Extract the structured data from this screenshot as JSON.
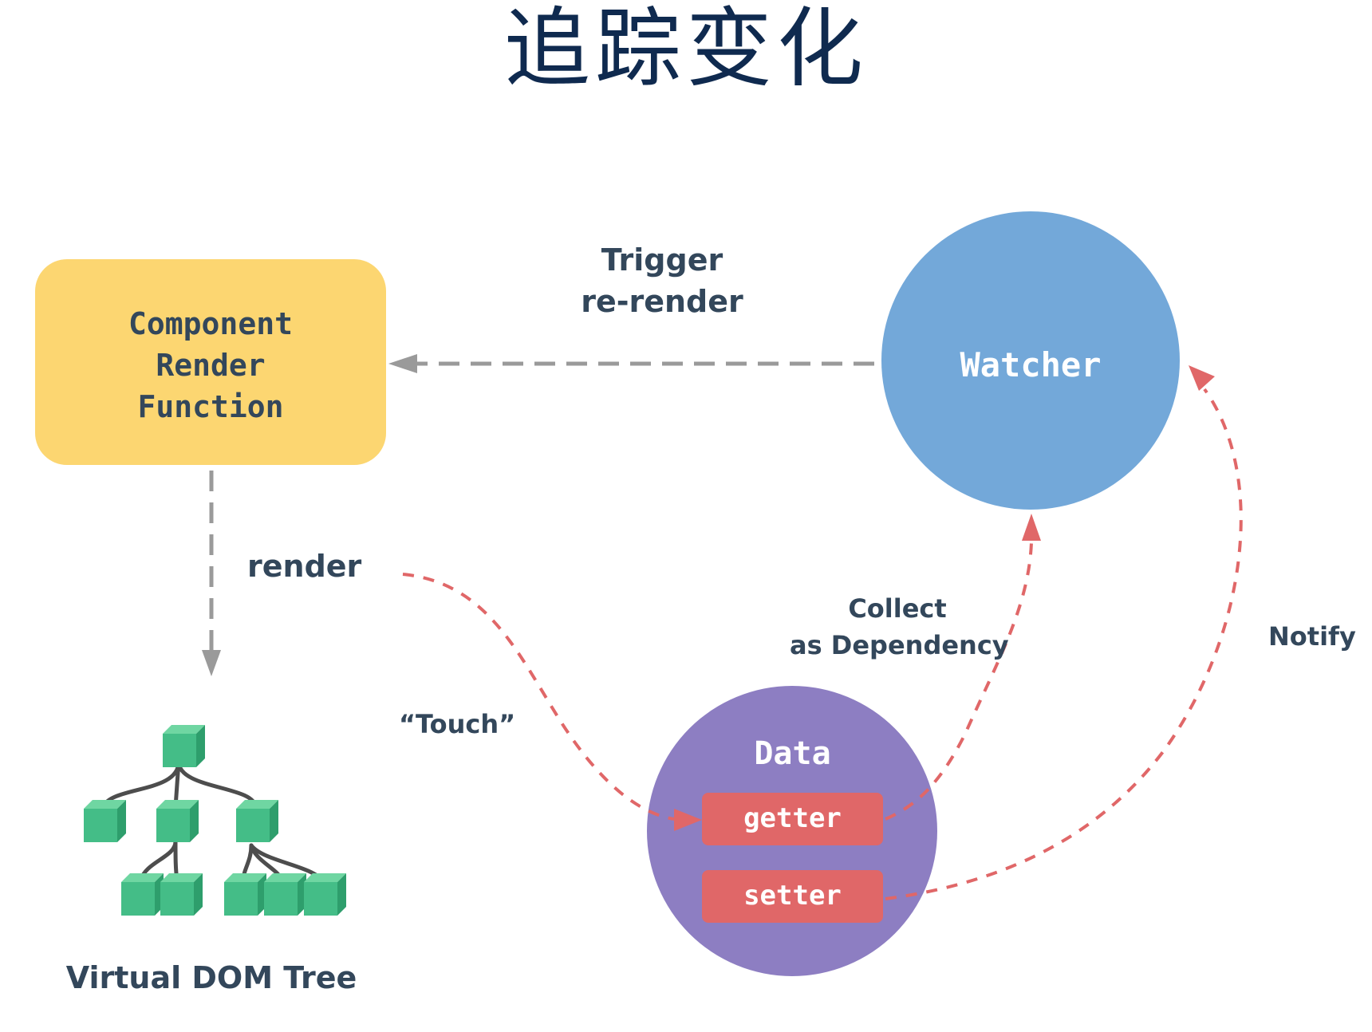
{
  "title": "追踪变化",
  "nodes": {
    "render_function": {
      "line1": "Component",
      "line2": "Render",
      "line3": "Function"
    },
    "watcher": {
      "label": "Watcher"
    },
    "data": {
      "label": "Data",
      "getter": "getter",
      "setter": "setter"
    },
    "vdom": {
      "label": "Virtual DOM Tree"
    }
  },
  "edges": {
    "trigger": {
      "line1": "Trigger",
      "line2": "re-render"
    },
    "render": {
      "label": "render"
    },
    "touch": {
      "label": "“Touch”"
    },
    "collect": {
      "line1": "Collect",
      "line2": "as Dependency"
    },
    "notify": {
      "label": "Notify"
    }
  },
  "colors": {
    "title": "#0f2a4f",
    "text": "#33475b",
    "render_box": "#fcd671",
    "watcher": "#73a8d9",
    "data": "#8d7ec2",
    "pill": "#e06768",
    "red_arrow": "#e06768",
    "gray_arrow": "#9a9a9a",
    "cube_top": "#6fd6a2",
    "cube_front": "#44bd87",
    "cube_side": "#2e9e6c",
    "tree_line": "#4d4d4d"
  }
}
